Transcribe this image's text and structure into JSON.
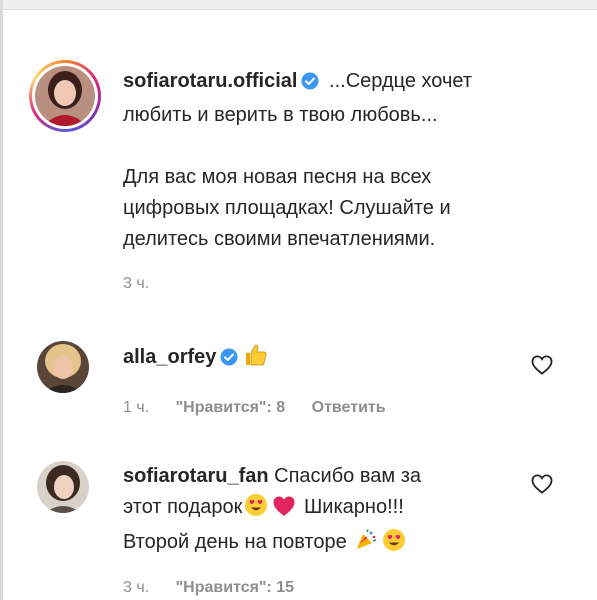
{
  "caption": {
    "username": "sofiarotaru.official",
    "text_line1": "...Сердце хочет",
    "text_line2": "любить и верить в твою любовь...",
    "text_line3": "Для вас моя новая песня на всех",
    "text_line4": "цифровых площадках! Слушайте и",
    "text_line5": "делитесь своими впечатлениями.",
    "time": "3 ч."
  },
  "comments": [
    {
      "username": "alla_orfey",
      "verified": true,
      "emoji": "thumbs-up",
      "time": "1 ч.",
      "likes": "\"Нравится\": 8",
      "reply": "Ответить"
    },
    {
      "username": "sofiarotaru_fan",
      "verified": false,
      "text_part1": "Спасибо вам за",
      "text_part2": "этот подарок",
      "text_part3": "Шикарно!!!",
      "text_part4": "Второй день на повторе",
      "time": "3 ч.",
      "likes": "\"Нравится\": 15"
    }
  ],
  "colors": {
    "text": "#262626",
    "meta": "#8e8e8e",
    "verified": "#3897f0"
  }
}
